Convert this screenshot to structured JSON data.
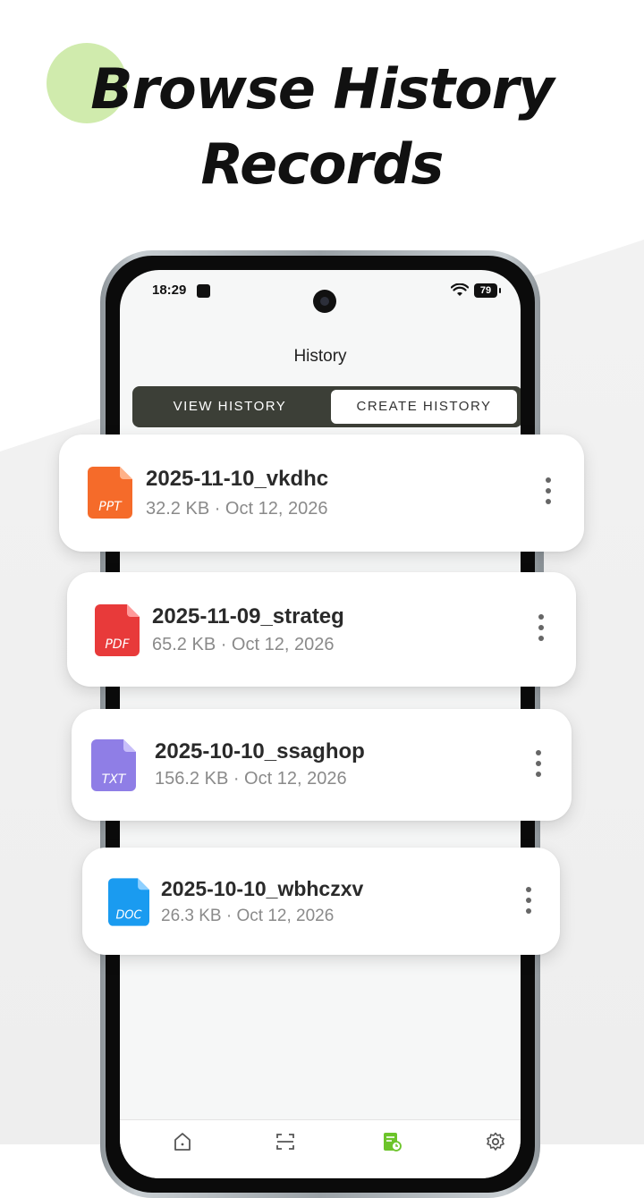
{
  "headline": {
    "line1": "Browse History",
    "line2": "Records"
  },
  "status_bar": {
    "time": "18:29",
    "battery": "79"
  },
  "screen": {
    "title": "History",
    "tabs": [
      {
        "label": "VIEW HISTORY",
        "active": true
      },
      {
        "label": "CREATE HISTORY",
        "active": false
      }
    ]
  },
  "files": [
    {
      "type": "PPT",
      "name": "2025-11-10_vkdhc",
      "meta": "32.2 KB · Oct 12, 2026",
      "color": "#f56b2a"
    },
    {
      "type": "PDF",
      "name": "2025-11-09_strateg",
      "meta": "65.2 KB · Oct 12, 2026",
      "color": "#e83a3a"
    },
    {
      "type": "TXT",
      "name": "2025-10-10_ssaghop",
      "meta": "156.2 KB · Oct 12, 2026",
      "color": "#8f7ee6"
    },
    {
      "type": "DOC",
      "name": "2025-10-10_wbhczxv",
      "meta": "26.3 KB · Oct 12, 2026",
      "color": "#1a9bf0"
    }
  ],
  "bottom_nav": [
    {
      "icon": "home-icon"
    },
    {
      "icon": "scan-icon"
    },
    {
      "icon": "history-icon",
      "active": true,
      "color": "#6cc42a"
    },
    {
      "icon": "settings-icon"
    }
  ],
  "colors": {
    "accent": "#cbe9a4",
    "toggle_bg": "#3c3f37"
  }
}
